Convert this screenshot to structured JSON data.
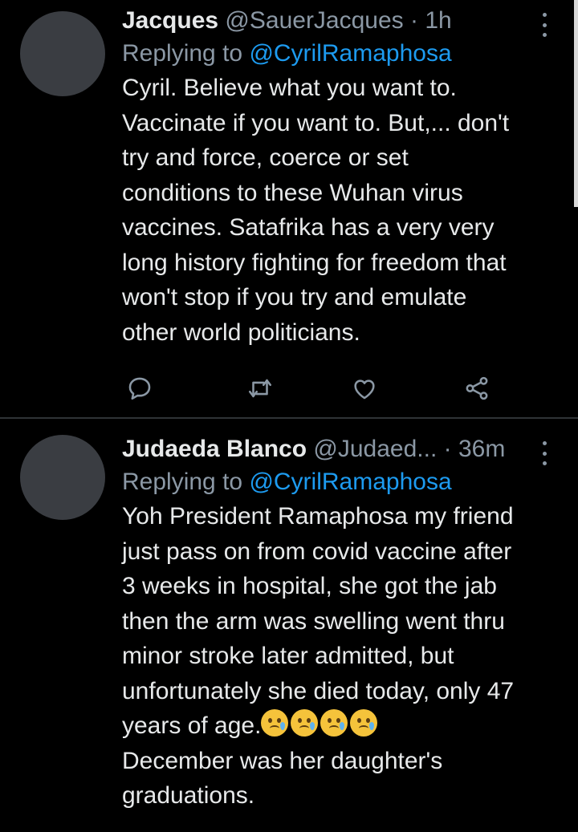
{
  "tweets": [
    {
      "display_name": "Jacques",
      "handle": "@SauerJacques",
      "separator": "·",
      "time": "1h",
      "replying_prefix": "Replying to",
      "replying_to": "@CyrilRamaphosa",
      "text": "Cyril.  Believe what you want to.\nVaccinate if you want to.  But,... don't\ntry and force, coerce or set\nconditions to these Wuhan virus\nvaccines.  Satafrika has a very very\nlong history fighting for freedom that\nwon't stop if you try and emulate\nother world politicians.",
      "actions": [
        "reply-icon",
        "retweet-icon",
        "like-icon",
        "share-icon"
      ]
    },
    {
      "display_name": "Judaeda Blanco",
      "handle": "@Judaed...",
      "separator": "·",
      "time": "36m",
      "replying_prefix": "Replying to",
      "replying_to": "@CyrilRamaphosa",
      "text_part1": "Yoh President Ramaphosa my friend\njust pass on from covid vaccine after\n3 weeks in hospital, she got the jab\nthen the arm was swelling went thru\nminor stroke later admitted, but\nunfortunately she died today, only 47\nyears of age.",
      "emojis": [
        "crying-face-emoji",
        "crying-face-emoji",
        "crying-face-emoji",
        "crying-face-emoji"
      ],
      "text_part2": "December was her daughter's\ngraduations."
    }
  ],
  "colors": {
    "background": "#000000",
    "text": "#e7e9ea",
    "secondary": "#8b98a5",
    "accent": "#1d9bf0",
    "divider": "#2f3336"
  }
}
